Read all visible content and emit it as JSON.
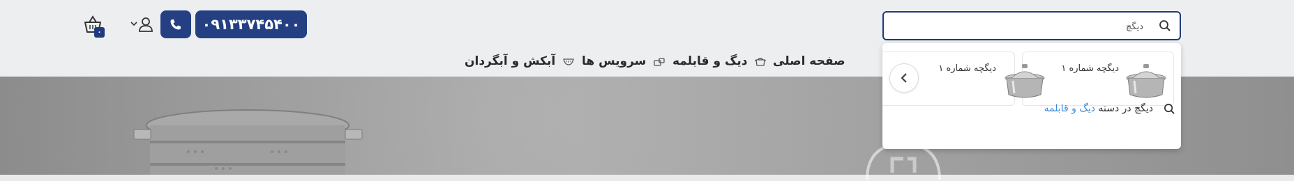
{
  "header": {
    "phone_number": "۰۹۱۳۳۷۴۵۴۰۰",
    "cart_count": "۰",
    "brand_color": "#243f82"
  },
  "search": {
    "value": "دیگچ",
    "cards": [
      {
        "title": "دیگچه شماره ۱"
      },
      {
        "title": "دیگچه شماره ۱"
      }
    ],
    "suggestion_prefix": "دیگچ در دسته",
    "suggestion_category": "دیگ و قابلمه",
    "link_color": "#3d8bd8"
  },
  "nav": {
    "items": [
      {
        "label": "صفحه اصلی"
      },
      {
        "label": "دیگ و قابلمه"
      },
      {
        "label": "سرویس ها"
      },
      {
        "label": "آبکش و آبگردان"
      }
    ]
  }
}
